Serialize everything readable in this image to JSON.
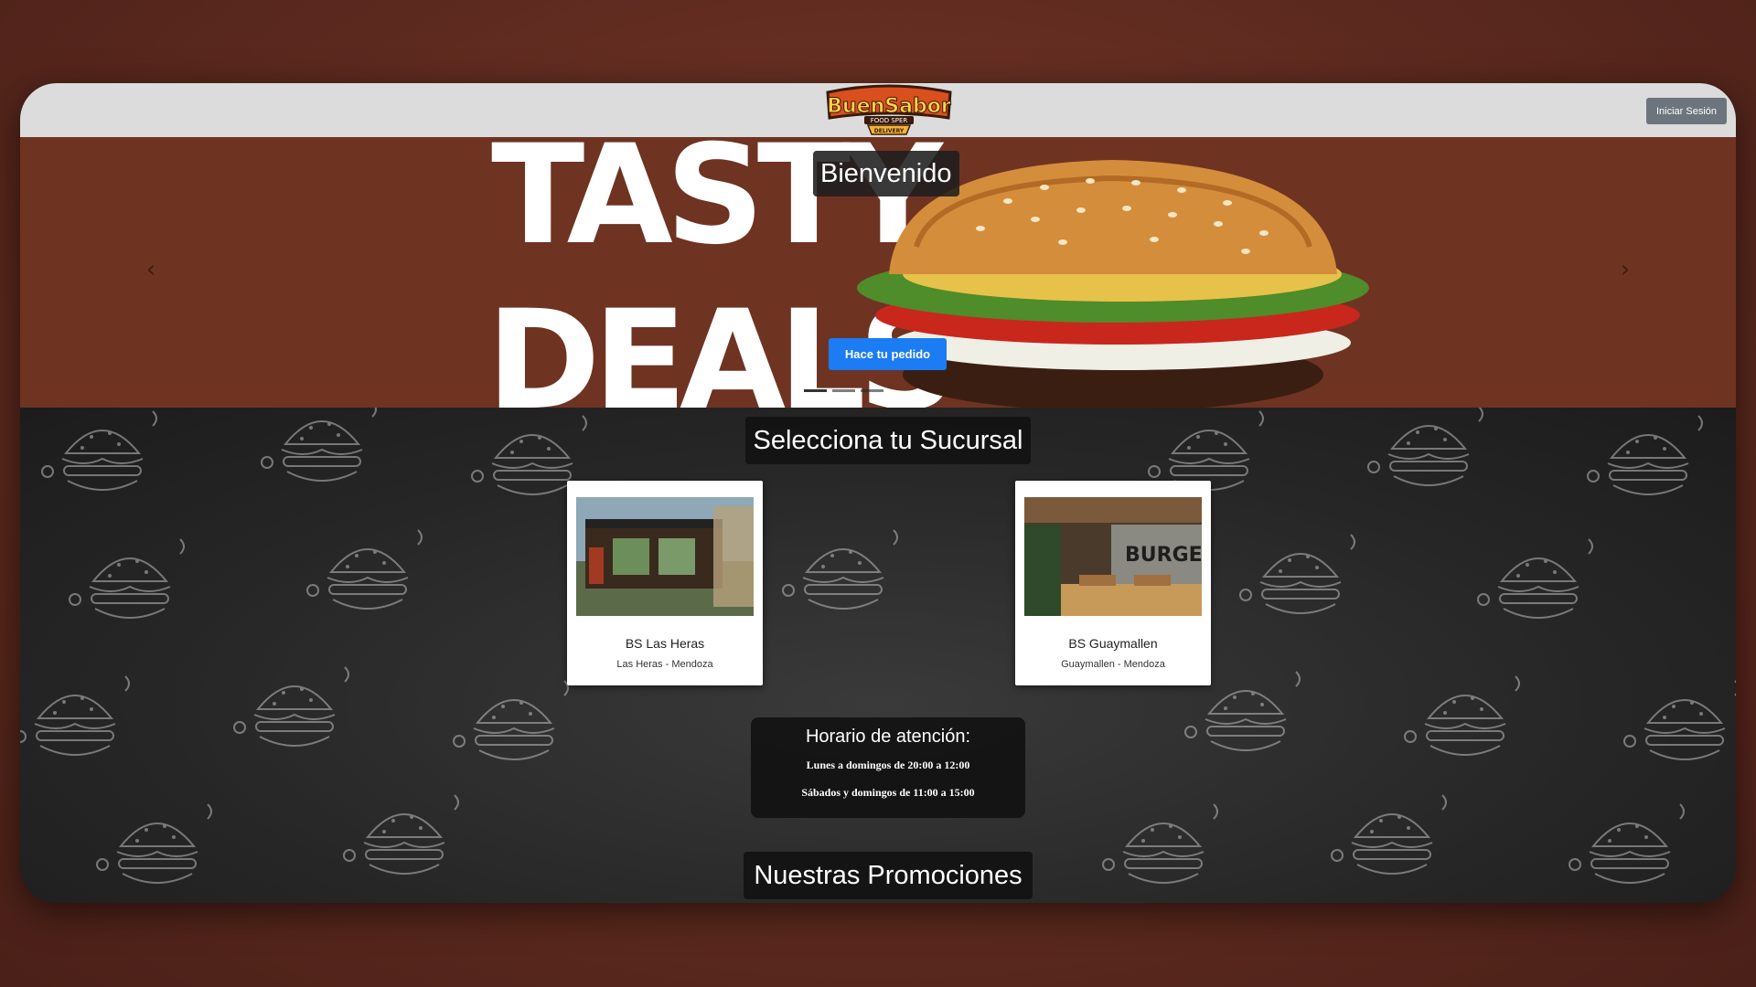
{
  "header": {
    "logo": {
      "name": "BuenSabor",
      "tagline_top": "FOOD SPER",
      "tagline_bottom": "DELIVERY"
    },
    "login_label": "Iniciar Sesión"
  },
  "hero": {
    "title": "Bienvenido",
    "banner_text_top": "TASTY",
    "banner_text_bottom": "DEALS",
    "order_button": "Hace tu pedido",
    "prev_icon": "chevron-left-icon",
    "next_icon": "chevron-right-icon",
    "slide_count": 3,
    "active_slide": 1
  },
  "branches": {
    "title": "Selecciona tu Sucursal",
    "items": [
      {
        "name": "BS Las Heras",
        "location": "Las Heras - Mendoza"
      },
      {
        "name": "BS Guaymallen",
        "location": "Guaymallen - Mendoza",
        "sign": "BURGER"
      }
    ]
  },
  "hours": {
    "title": "Horario de atención:",
    "line1": "Lunes a domingos de 20:00 a 12:00",
    "line2": "Sábados y domingos de 11:00 a 15:00"
  },
  "promotions": {
    "title": "Nuestras Promociones"
  },
  "colors": {
    "hero_bg": "#6f3322",
    "header_bg": "#dcdcdc",
    "primary": "#1b7cf3",
    "secondary": "#6c757d",
    "desktop_bg": "#5e2a1f"
  }
}
